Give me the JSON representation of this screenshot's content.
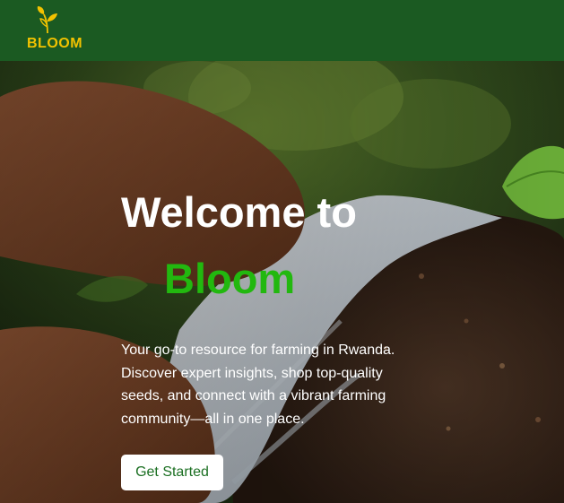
{
  "header": {
    "brand_name": "BLOOM",
    "logo_icon": "sprout-leaf-icon"
  },
  "hero": {
    "title_line1": "Welcome to",
    "title_line2": "Bloom",
    "description": "Your go-to resource for farming in Rwanda. Discover expert insights, shop top-quality seeds, and connect with a vibrant farming community—all in one place.",
    "cta_label": "Get Started",
    "background_description_icon": "hands-planting-seedling-photo"
  },
  "colors": {
    "header_bg": "#1b5a22",
    "logo_yellow": "#f2c200",
    "brand_green": "#22b80f",
    "cta_text": "#1b6f22",
    "cta_bg": "#ffffff"
  }
}
